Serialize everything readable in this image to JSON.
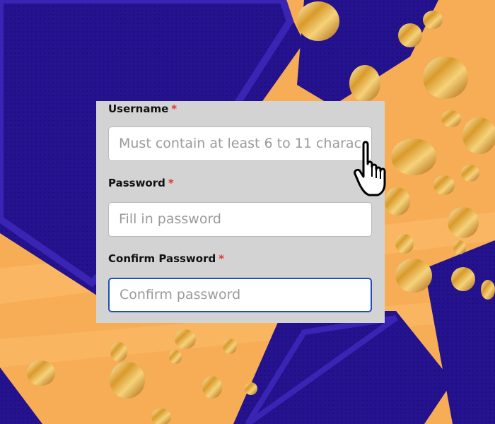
{
  "colors": {
    "background_orange": "#f7ad55",
    "hexagon_navy": "#24128e",
    "panel_gray": "#d3d3d3",
    "focus_blue": "#1d4fc0",
    "required_red": "#e43434"
  },
  "form": {
    "username": {
      "label": "Username",
      "required_mark": "*",
      "placeholder": "Must contain at least 6 to 11 charac"
    },
    "password": {
      "label": "Password",
      "required_mark": "*",
      "placeholder": "Fill in password"
    },
    "confirm_password": {
      "label": "Confirm Password",
      "required_mark": "*",
      "placeholder": "Confirm password",
      "focused": true
    }
  },
  "cursor": {
    "icon": "pointer-hand-icon"
  }
}
